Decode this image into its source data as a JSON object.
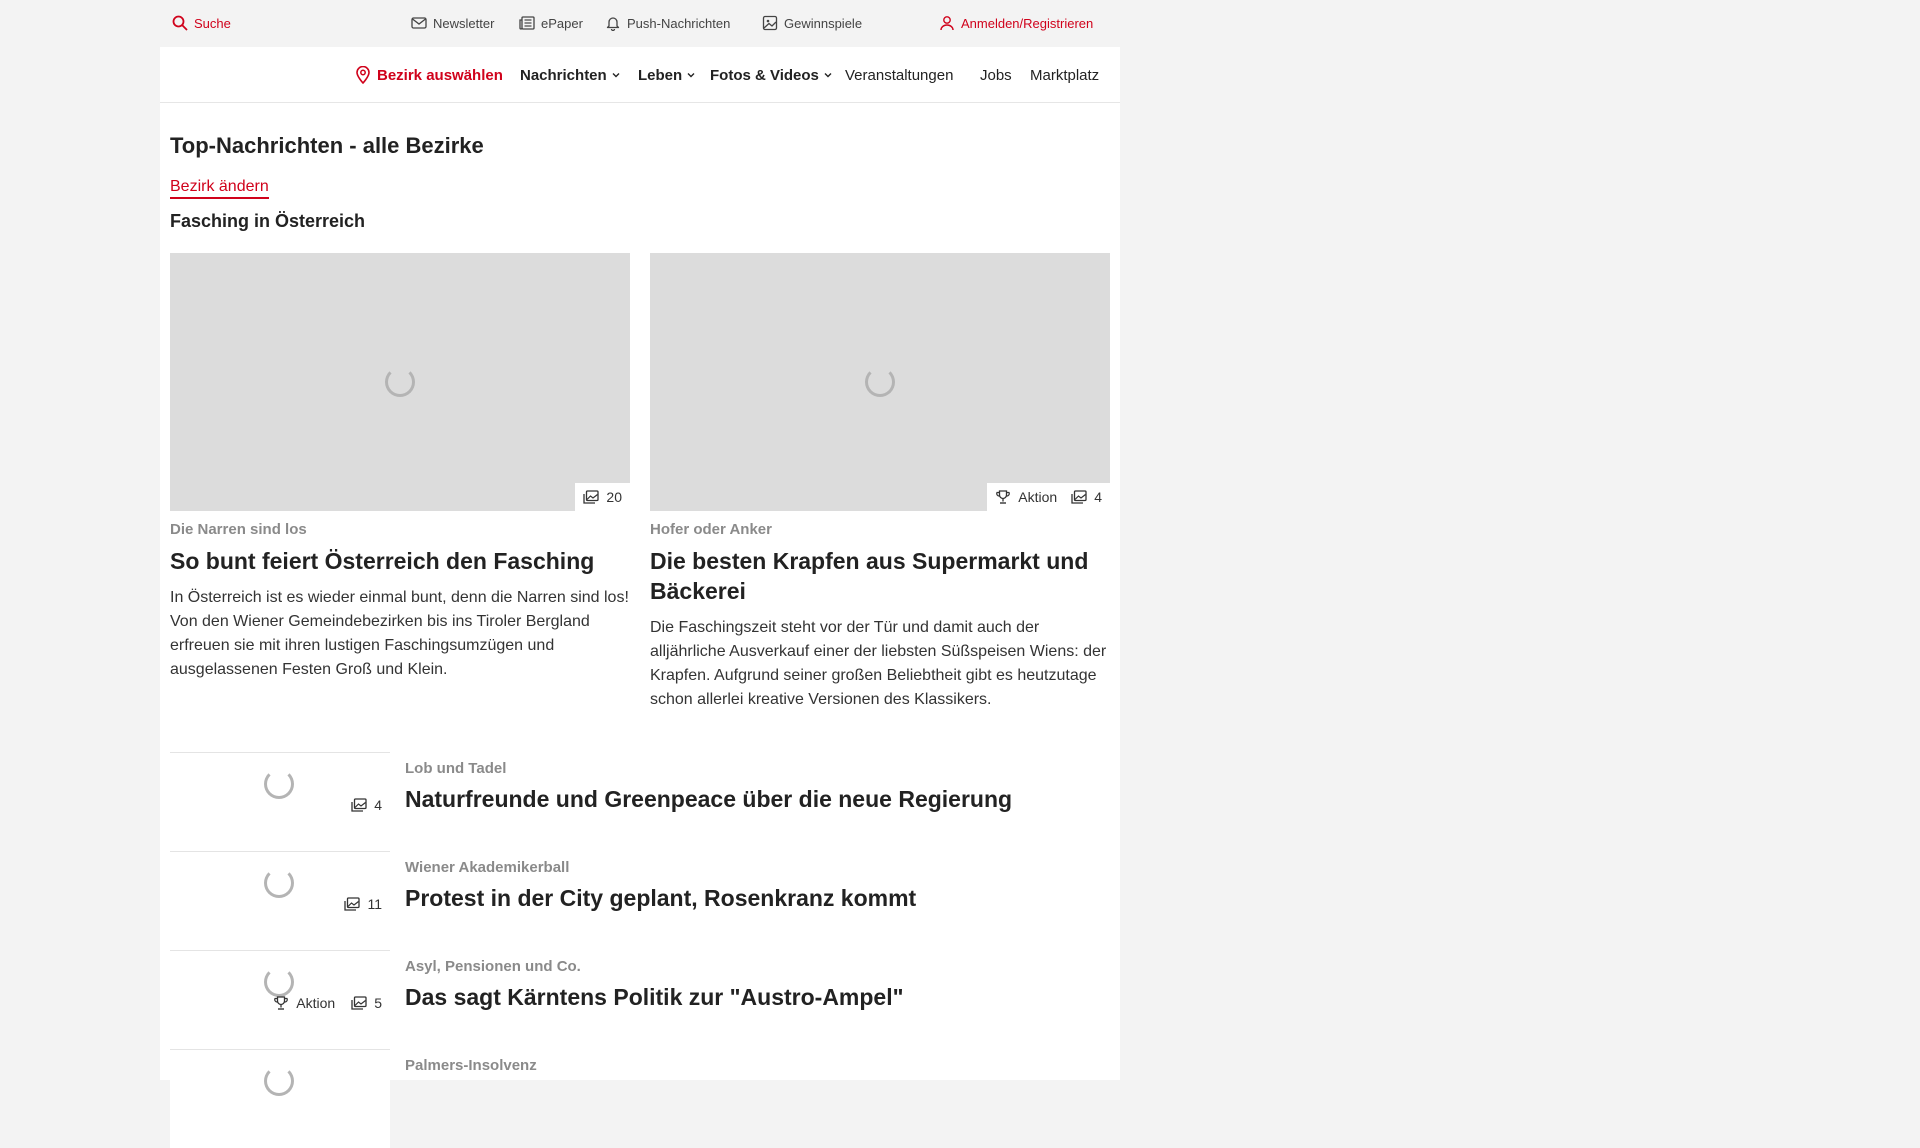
{
  "topbar": {
    "search": "Suche",
    "newsletter": "Newsletter",
    "epaper": "ePaper",
    "push": "Push-Nachrichten",
    "contests": "Gewinnspiele",
    "login": "Anmelden/Registrieren"
  },
  "nav": {
    "district": "Bezirk auswählen",
    "news": "Nachrichten",
    "life": "Leben",
    "media": "Fotos & Videos",
    "events": "Veranstaltungen",
    "jobs": "Jobs",
    "market": "Marktplatz"
  },
  "page": {
    "title": "Top-Nachrichten - alle Bezirke",
    "change_link": "Bezirk ändern",
    "section_title": "Fasching in Österreich"
  },
  "featured": [
    {
      "kicker": "Die Narren sind los",
      "headline": "So bunt feiert Österreich den Fasching",
      "teaser": "In Österreich ist es wieder einmal bunt, denn die Narren sind los! Von den Wiener Gemeindebezirken bis ins Tiroler Bergland erfreuen sie mit ihren lustigen Faschingsumzügen und ausgelassenen Festen Groß und Klein.",
      "image_count": "20"
    },
    {
      "kicker": "Hofer oder Anker",
      "headline": "Die besten Krapfen aus Supermarkt und Bäckerei",
      "teaser": "Die Faschingszeit steht vor der Tür und damit auch der alljährliche Ausverkauf einer der liebsten Süßspeisen Wiens: der Krapfen. Aufgrund seiner großen Beliebtheit gibt es heutzutage schon allerlei kreative Versionen des Klassikers.",
      "action": "Aktion",
      "image_count": "4"
    }
  ],
  "list": [
    {
      "kicker": "Lob und Tadel",
      "headline": "Naturfreunde und Greenpeace über die neue Regierung",
      "image_count": "4"
    },
    {
      "kicker": "Wiener Akademikerball",
      "headline": "Protest in der City geplant, Rosenkranz kommt",
      "image_count": "11"
    },
    {
      "kicker": "Asyl, Pensionen und Co.",
      "headline": "Das sagt Kärntens Politik zur \"Austro-Ampel\"",
      "action": "Aktion",
      "image_count": "5"
    },
    {
      "kicker": "Palmers-Insolvenz",
      "headline": ""
    }
  ],
  "colors": {
    "accent": "#d0021b",
    "page_bg": "#f3f3f3",
    "image_placeholder": "#dcdcdc"
  }
}
